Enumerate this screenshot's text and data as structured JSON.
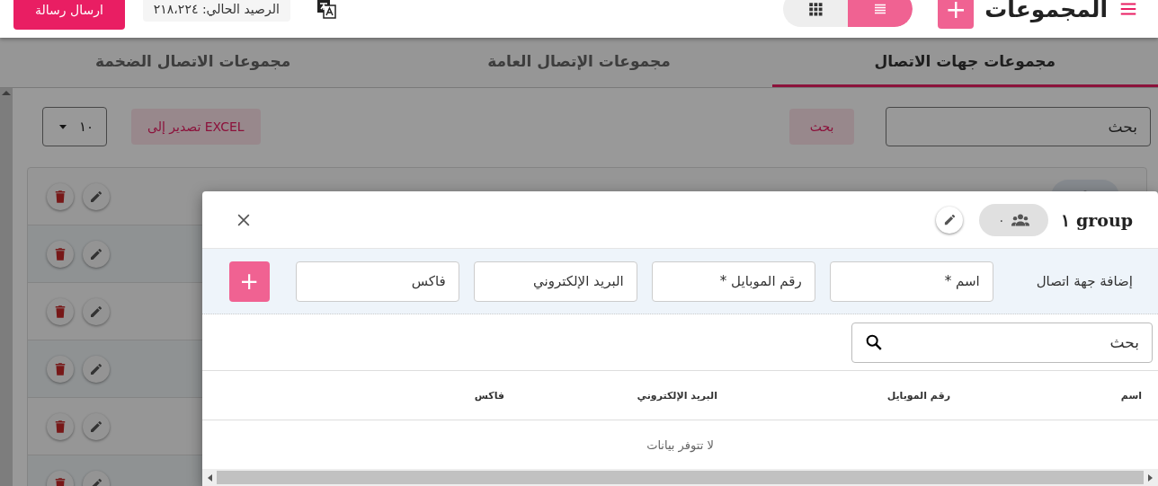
{
  "header": {
    "title": "المجموعات",
    "add_button": "+",
    "view_toggle": [
      {
        "kind": "list",
        "selected": true
      },
      {
        "kind": "grid",
        "selected": false
      }
    ],
    "balance": "الرصيد الحالي: ٢١٨،٢٢٤",
    "send_button": "ارسال رسالة"
  },
  "tabs": [
    {
      "label": "مجموعات جهات الاتصال",
      "selected": true
    },
    {
      "label": "مجموعات الإتصال العامة",
      "selected": false
    },
    {
      "label": "مجموعات الاتصال الضخمة",
      "selected": false
    }
  ],
  "toolbar": {
    "search": {
      "placeholder": "بحث"
    },
    "search_button": "بحث",
    "export_button": "تصدير إلى EXCEL",
    "page_size": "١٠"
  },
  "group_rows": [
    {
      "kind": "group"
    },
    {
      "kind": "plain"
    },
    {
      "kind": "plain"
    },
    {
      "kind": "plain"
    },
    {
      "kind": "plain"
    },
    {
      "kind": "plain"
    }
  ],
  "dialog": {
    "title": "group ١",
    "member_count": "٠",
    "add_contact": {
      "label": "إضافة جهة اتصال",
      "fields": [
        {
          "placeholder": "اسم *"
        },
        {
          "placeholder": "رقم الموبايل *"
        },
        {
          "placeholder": "البريد الإلكتروني"
        },
        {
          "placeholder": "فاكس"
        }
      ],
      "add_button": "+"
    },
    "search": {
      "placeholder": "بحث"
    },
    "table": {
      "columns": [
        "اسم",
        "رقم الموبايل",
        "البريد الإلكتروني",
        "فاكس"
      ],
      "empty_text": "لا تتوفر بيانات"
    }
  }
}
